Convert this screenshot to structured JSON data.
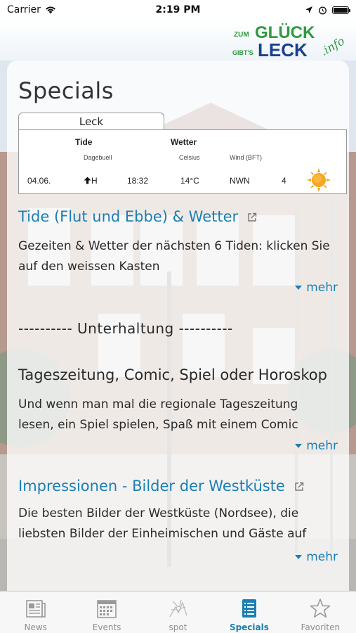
{
  "status": {
    "carrier": "Carrier",
    "time": "2:19 PM",
    "battery_level": 1.0
  },
  "header": {
    "logo_line1_small": "ZUM",
    "logo_line1_big": "GLÜCK",
    "logo_line2_small": "GIBT'S",
    "logo_line2_big": "LECK",
    "logo_suffix": ".info"
  },
  "page": {
    "title": "Specials"
  },
  "weather_widget": {
    "location_tab": "Leck",
    "tide_header": "Tide",
    "tide_sub": "Dagebuell",
    "weather_header": "Wetter",
    "celsius_sub": "Celsius",
    "wind_sub": "Wind (BFT)",
    "row": {
      "date": "04.06.",
      "tide_type": "H",
      "time": "18:32",
      "temperature": "14°C",
      "wind_dir": "NWN",
      "wind_force": "4"
    },
    "weather_icon": "sun-icon"
  },
  "sections": [
    {
      "title": "Tide (Flut und Ebbe) & Wetter",
      "text_line1": "Gezeiten & Wetter der nächsten 6 Tiden: klicken Sie",
      "text_line2": "auf den weissen Kasten",
      "more": "mehr"
    },
    {
      "divider": "---------- Unterhaltung ----------"
    },
    {
      "title": "Tageszeitung, Comic, Spiel oder Horoskop",
      "text_line1": "Und wenn man mal die regionale Tageszeitung",
      "text_line2": "lesen, ein Spiel spielen, Spaß mit einem Comic",
      "more": "mehr"
    },
    {
      "title": "Impressionen - Bilder der Westküste",
      "text_line1": "Die besten Bilder der Westküste (Nordsee), die",
      "text_line2": "liebsten Bilder der Einheimischen und Gäste auf",
      "more": "mehr"
    }
  ],
  "tabs": [
    {
      "label": "News",
      "icon": "newspaper-icon"
    },
    {
      "label": "Events",
      "icon": "calendar-icon"
    },
    {
      "label": "spot",
      "icon": "spot-icon"
    },
    {
      "label": "Specials",
      "icon": "list-icon",
      "active": true
    },
    {
      "label": "Favoriten",
      "icon": "star-icon"
    }
  ],
  "colors": {
    "accent": "#1a7fb3",
    "logo_green": "#2e9a3e",
    "logo_blue": "#1b3f8f",
    "tab_inactive": "#8e8e8e"
  }
}
